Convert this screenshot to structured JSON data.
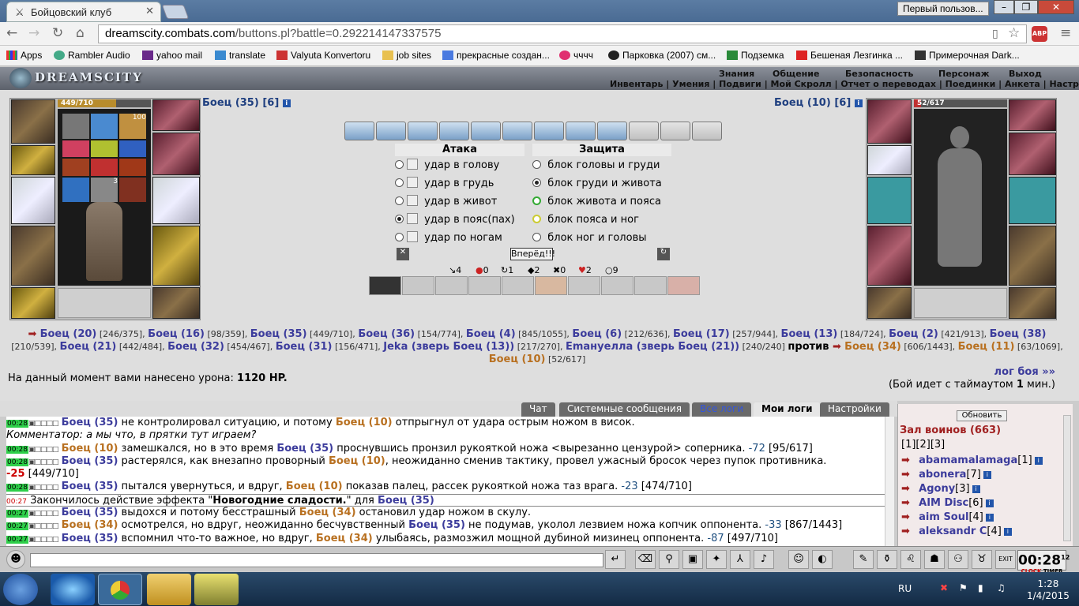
{
  "browser": {
    "tab_title": "Бойцовский клуб",
    "user_button": "Первый пользов...",
    "url_host": "dreamscity.combats.com",
    "url_path": "/buttons.pl?battle=0.292214147337575",
    "abp": "ABP"
  },
  "bookmarks": [
    "Apps",
    "Rambler Audio",
    "yahoo mail",
    "translate",
    "Valyuta Konvertoru",
    "job sites",
    "прекрасные создан...",
    "чччч",
    "Парковка (2007) см...",
    "Подземка",
    "Бешеная Лезгинка ...",
    "Примерочная Dark..."
  ],
  "game": {
    "logo": "DREAMSCITY",
    "menu_top": [
      "Знания",
      "Общение",
      "Безопасность",
      "Персонаж",
      "Выход"
    ],
    "menu_bottom": "Инвентарь | Умения | Подвиги | Мой Скролл | Отчет о переводах | Поединки | Анкета | Настройки"
  },
  "player_left": {
    "name": "Боец (35)",
    "level": "[6]",
    "hp": "449/710",
    "hp_fraction": 0.63,
    "potion_count": "100",
    "stack_count": "3"
  },
  "player_right": {
    "name": "Боец (10)",
    "level": "[6]",
    "hp": "52/617",
    "hp_fraction": 0.08
  },
  "attack": {
    "title": "Атака",
    "options": [
      "удар в голову",
      "удар в грудь",
      "удар в живот",
      "удар в пояс(пах)",
      "удар по ногам"
    ],
    "selected": 3
  },
  "defense": {
    "title": "Защита",
    "options": [
      "блок головы и груди",
      "блок груди и живота",
      "блок живота и пояса",
      "блок пояса и ног",
      "блок ног и головы"
    ],
    "selected": 1
  },
  "go_button": "Вперёд!!!",
  "stats": [
    "4",
    "0",
    "1",
    "2",
    "0",
    "2",
    "9"
  ],
  "teams": {
    "team1": [
      [
        "Боец (20)",
        "[246/375]"
      ],
      [
        "Боец (16)",
        "[98/359]"
      ],
      [
        "Боец (35)",
        "[449/710]"
      ],
      [
        "Боец (36)",
        "[154/774]"
      ],
      [
        "Боец (4)",
        "[845/1055]"
      ],
      [
        "Боец (6)",
        "[212/636]"
      ],
      [
        "Боец (17)",
        "[257/944]"
      ],
      [
        "Боец (13)",
        "[184/724]"
      ],
      [
        "Боец (2)",
        "[421/913]"
      ],
      [
        "Боец (38)",
        "[210/539]"
      ],
      [
        "Боец (21)",
        "[442/484]"
      ],
      [
        "Боец (32)",
        "[454/467]"
      ],
      [
        "Боец (31)",
        "[156/471]"
      ],
      [
        "Jeka (зверь Боец (13))",
        "[217/270]"
      ],
      [
        "Еmануелла (зверь Боец (21))",
        "[240/240]"
      ]
    ],
    "versus": "против",
    "team2": [
      [
        "Боец (34)",
        "[606/1443]"
      ],
      [
        "Боец (11)",
        "[63/1069]"
      ],
      [
        "Боец (10)",
        "[52/617]"
      ]
    ]
  },
  "damage_text": "На данный момент вами нанесено урона:",
  "damage_value": "1120 HP.",
  "log_link": "лог боя »»",
  "timeout_pre": "(Бой идет с таймаутом",
  "timeout_val": "1",
  "timeout_post": "мин.)",
  "tabs": [
    "Чат",
    "Системные сообщения",
    "Все логи",
    "Мои логи",
    "Настройки"
  ],
  "log": [
    {
      "t": "00:28",
      "parts": [
        [
          "b",
          "Боец (35)"
        ],
        [
          "n",
          " не контролировал ситуацию, и потому "
        ],
        [
          "o",
          "Боец (10)"
        ],
        [
          "n",
          " отпрыгнул от удара острым ножом в висок."
        ]
      ]
    },
    {
      "t": "",
      "parts": [
        [
          "i",
          "Комментатор: а мы что, в прятки тут играем?"
        ]
      ]
    },
    {
      "t": "00:28",
      "parts": [
        [
          "o",
          "Боец (10)"
        ],
        [
          "n",
          " замешкался, но в это время "
        ],
        [
          "b",
          "Боец (35)"
        ],
        [
          "n",
          " проснувшись пронзил рукояткой ножа <вырезанно цензурой> соперника. "
        ],
        [
          "v",
          "-72"
        ],
        [
          "n",
          " [95/617]"
        ]
      ]
    },
    {
      "t": "00:28",
      "parts": [
        [
          "b",
          "Боец (35)"
        ],
        [
          "n",
          " растерялся, как внезапно проворный "
        ],
        [
          "o",
          "Боец (10)"
        ],
        [
          "n",
          ", неожиданно сменив тактику, провел ужасный бросок через пупок противника."
        ]
      ]
    },
    {
      "t": "",
      "parts": [
        [
          "r",
          "-25"
        ],
        [
          "n",
          " [449/710]"
        ]
      ]
    },
    {
      "t": "00:28",
      "parts": [
        [
          "b",
          "Боец (35)"
        ],
        [
          "n",
          " пытался увернуться, и вдруг, "
        ],
        [
          "o",
          "Боец (10)"
        ],
        [
          "n",
          " показав палец, рассек рукояткой ножа таз врага. "
        ],
        [
          "v",
          "-23"
        ],
        [
          "n",
          " [474/710]"
        ]
      ]
    },
    {
      "t": "00:27r",
      "parts": [
        [
          "n",
          "Закончилось действие эффекта \""
        ],
        [
          "k",
          "Новогодние сладости."
        ],
        [
          "n",
          "\" для "
        ],
        [
          "b",
          "Боец (35)"
        ]
      ]
    },
    {
      "t": "00:27",
      "parts": [
        [
          "b",
          "Боец (35)"
        ],
        [
          "n",
          " выдохся и потому бесстрашный "
        ],
        [
          "o",
          "Боец (34)"
        ],
        [
          "n",
          " остановил удар ножом в скулу."
        ]
      ]
    },
    {
      "t": "00:27",
      "parts": [
        [
          "o",
          "Боец (34)"
        ],
        [
          "n",
          " осмотрелся, но вдруг, неожиданно бесчувственный "
        ],
        [
          "b",
          "Боец (35)"
        ],
        [
          "n",
          " не подумав, уколол лезвием ножа копчик оппонента. "
        ],
        [
          "v",
          "-33"
        ],
        [
          "n",
          " [867/1443]"
        ]
      ]
    },
    {
      "t": "00:27",
      "parts": [
        [
          "b",
          "Боец (35)"
        ],
        [
          "n",
          " вспомнил что-то важное, но вдруг, "
        ],
        [
          "o",
          "Боец (34)"
        ],
        [
          "n",
          " улыбаясь, размозжил мощной дубиной мизинец оппонента. "
        ],
        [
          "v",
          "-87"
        ],
        [
          "n",
          " [497/710]"
        ]
      ]
    }
  ],
  "side": {
    "refresh": "Обновить",
    "hall": "Зал воинов (663)",
    "pages": "[1][2][3]",
    "players": [
      [
        "abamamalamaga",
        "[1]"
      ],
      [
        "abonera",
        "[7]"
      ],
      [
        "Agony",
        "[3]"
      ],
      [
        "AIM Disc",
        "[6]"
      ],
      [
        "aim Soul",
        "[4]"
      ],
      [
        "aleksandr C",
        "[4]"
      ]
    ]
  },
  "clock": "00:28",
  "clock_small": "12",
  "clock_label": "CLOCK",
  "timer_label": "TIMER",
  "exit_label": "EXIT",
  "taskbar": {
    "lang": "RU",
    "time": "1:28",
    "date": "1/4/2015"
  }
}
